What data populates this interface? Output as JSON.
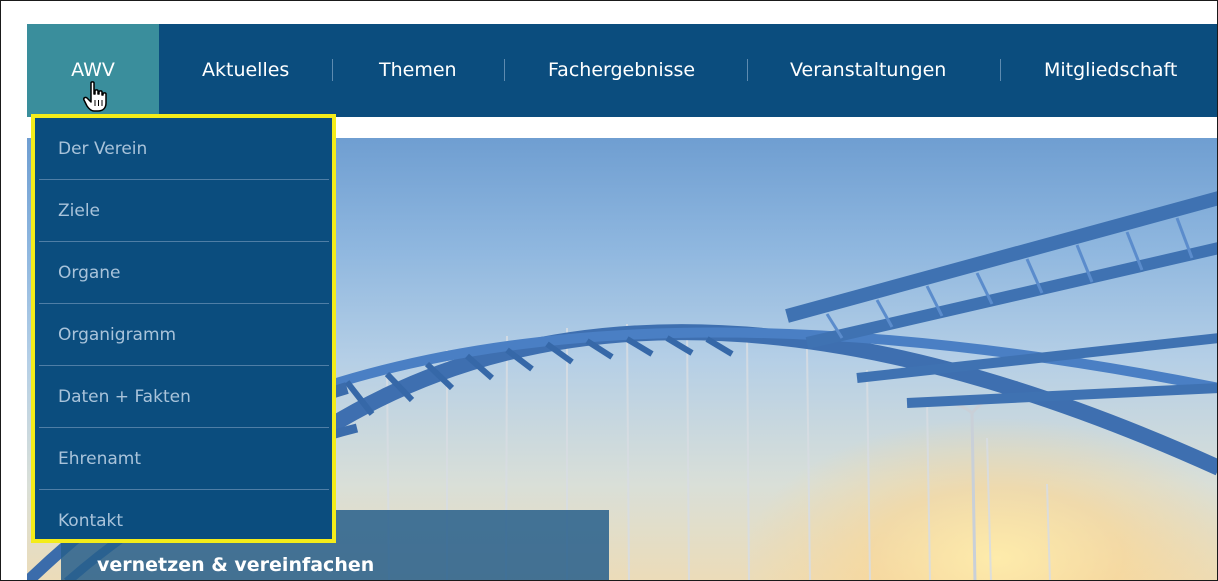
{
  "colors": {
    "nav_background": "#0b4d7e",
    "nav_active": "#3a8e9c",
    "dropdown_border": "#f4ec1a",
    "dropdown_text": "#a9c3da"
  },
  "nav": {
    "items": [
      {
        "label": "AWV",
        "active": true
      },
      {
        "label": "Aktuelles"
      },
      {
        "label": "Themen"
      },
      {
        "label": "Fachergebnisse"
      },
      {
        "label": "Veranstaltungen"
      },
      {
        "label": "Mitgliedschaft"
      }
    ],
    "cursor_icon": "hand-pointer-icon"
  },
  "dropdown": {
    "items": [
      {
        "label": "Der Verein"
      },
      {
        "label": "Ziele"
      },
      {
        "label": "Organe"
      },
      {
        "label": "Organigramm"
      },
      {
        "label": "Daten + Fakten"
      },
      {
        "label": "Ehrenamt"
      },
      {
        "label": "Kontakt"
      }
    ]
  },
  "hero": {
    "caption": "vernetzen & vereinfachen"
  }
}
